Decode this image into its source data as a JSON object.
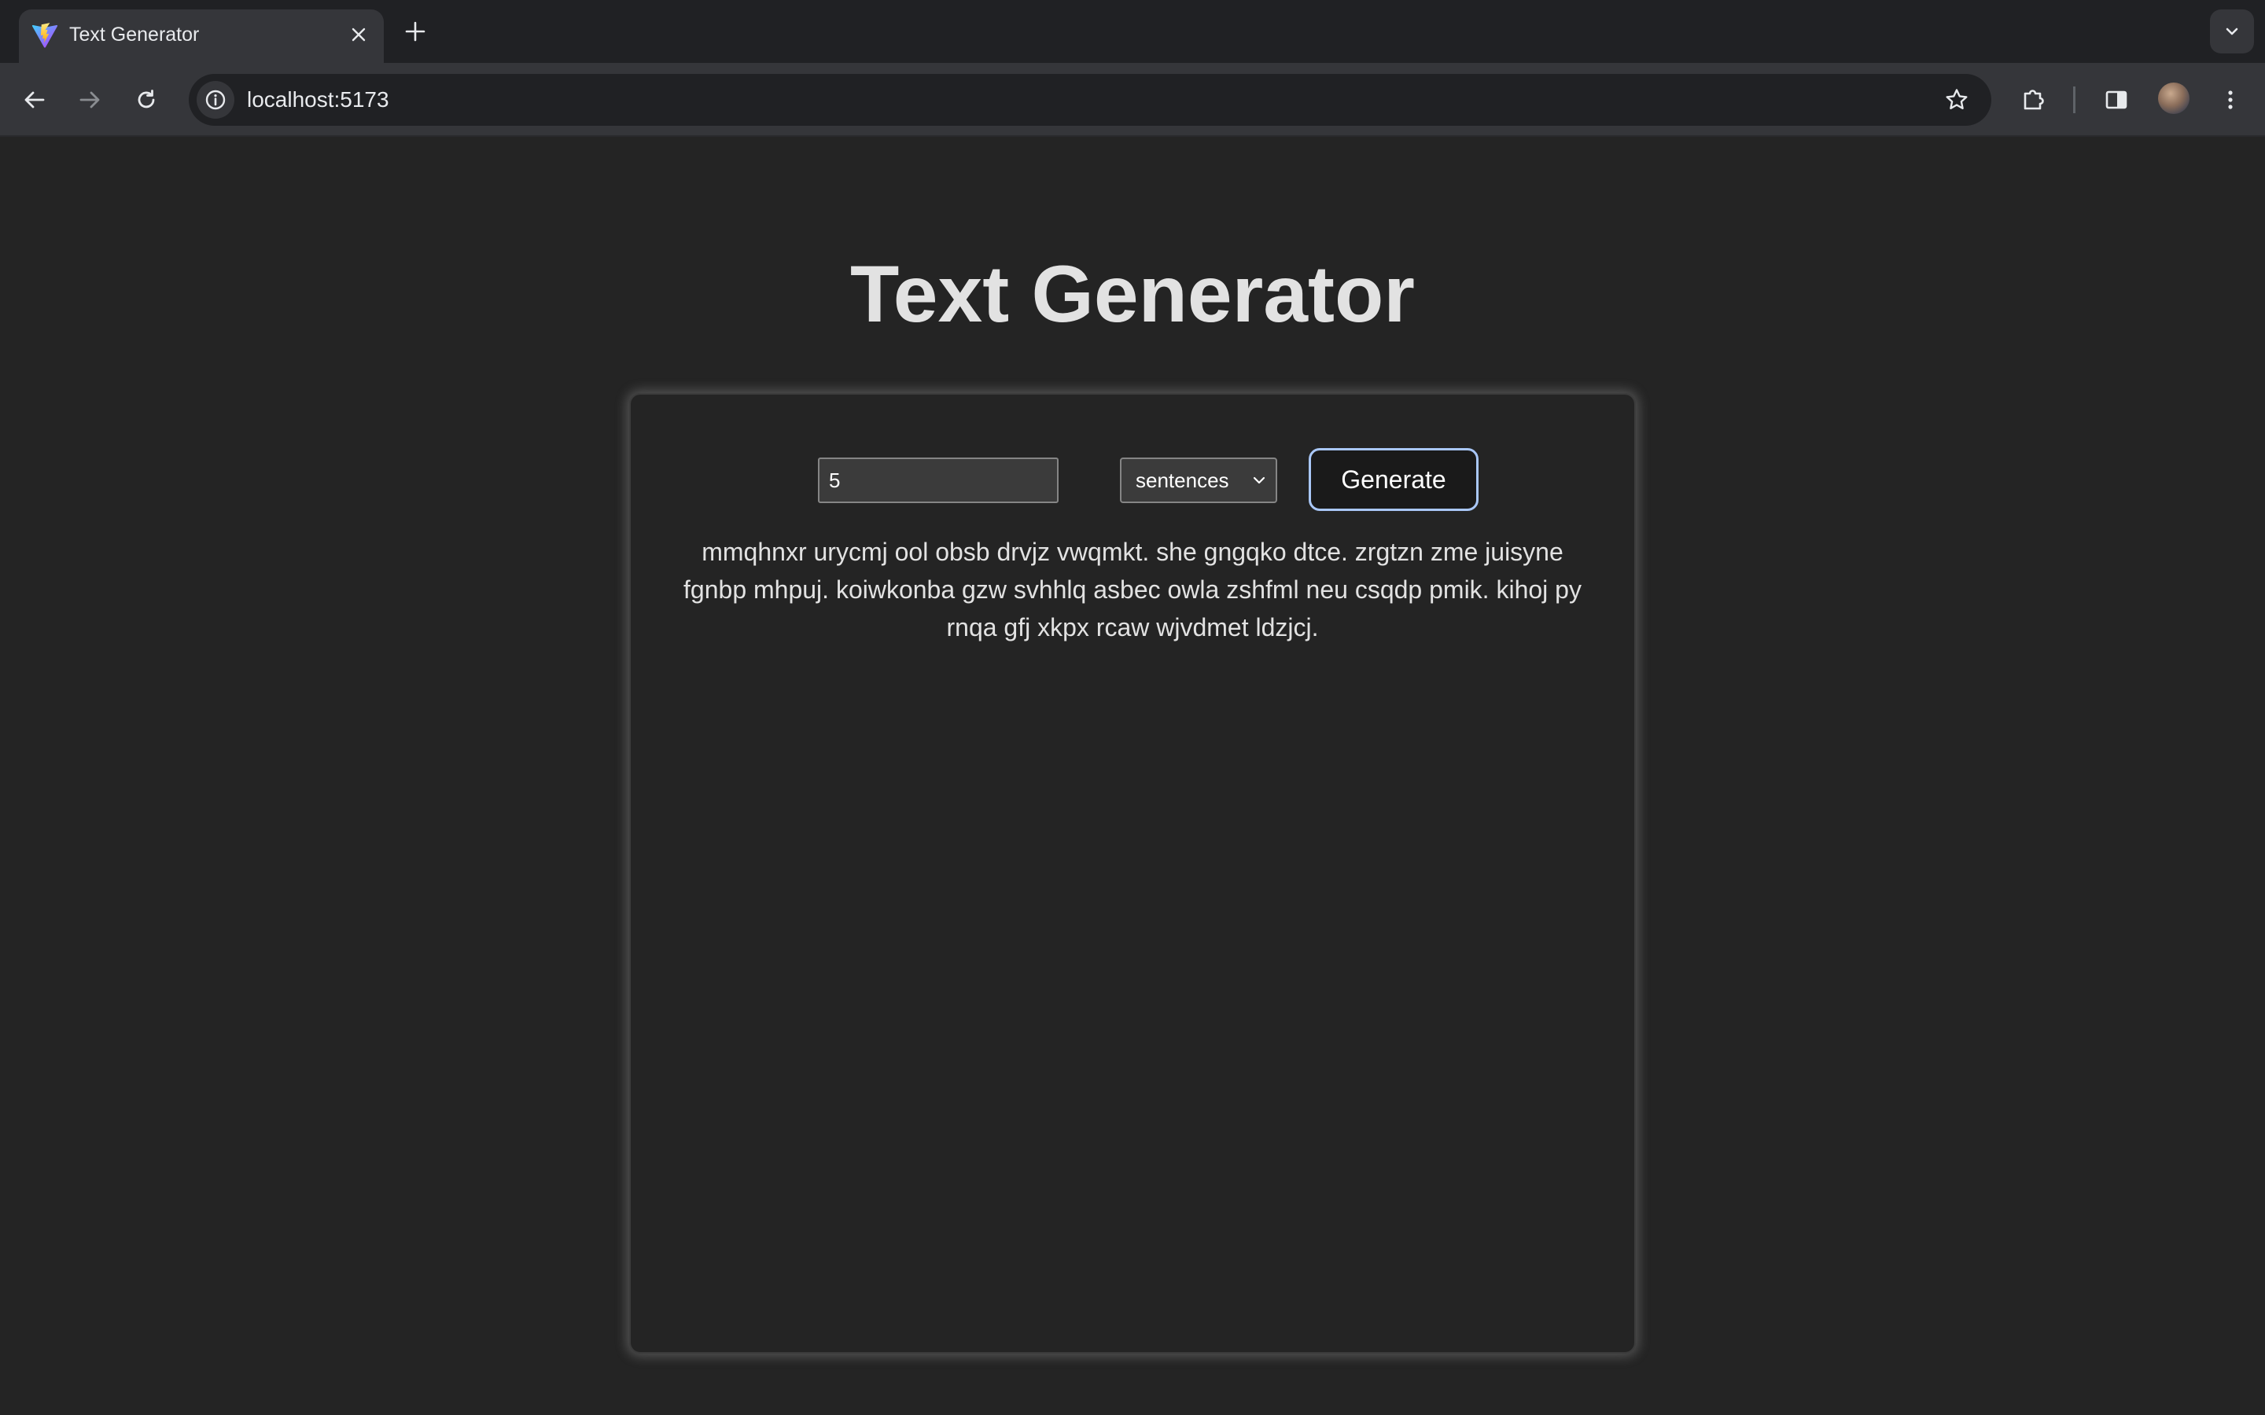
{
  "browser": {
    "tab": {
      "title": "Text Generator",
      "favicon": "vite-logo-icon"
    },
    "address_bar": {
      "url": "localhost:5173"
    }
  },
  "page": {
    "title": "Text Generator",
    "controls": {
      "count_value": "5",
      "unit_selected": "sentences",
      "generate_label": "Generate"
    },
    "output": "mmqhnxr urycmj ool obsb drvjz vwqmkt. she gngqko dtce. zrgtzn zme juisyne fgnbp mhpuj. koiwkonba gzw svhhlq asbec owla zshfml neu csqdp pmik. kihoj py rnqa gfj xkpx rcaw wjvdmet ldzjcj."
  },
  "colors": {
    "page_background": "#242424",
    "button_focus_ring": "#a9c7f7",
    "chrome_background": "#35363a"
  }
}
